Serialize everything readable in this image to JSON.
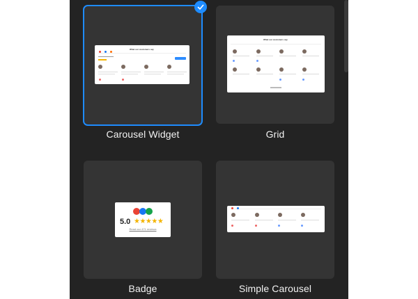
{
  "panel": {
    "background": "#232323"
  },
  "templates": [
    {
      "label": "Carousel Widget",
      "selected": true
    },
    {
      "label": "Grid",
      "selected": false
    },
    {
      "label": "Badge",
      "selected": false
    },
    {
      "label": "Simple Carousel",
      "selected": false
    }
  ],
  "previews": {
    "heading": "What our customers say",
    "badge": {
      "score": "5.0",
      "stars": "★★★★★",
      "link": "Read our 471 reviews"
    }
  },
  "colors": {
    "accent": "#1e8cff",
    "card": "#343434",
    "star": "#f4b400"
  }
}
